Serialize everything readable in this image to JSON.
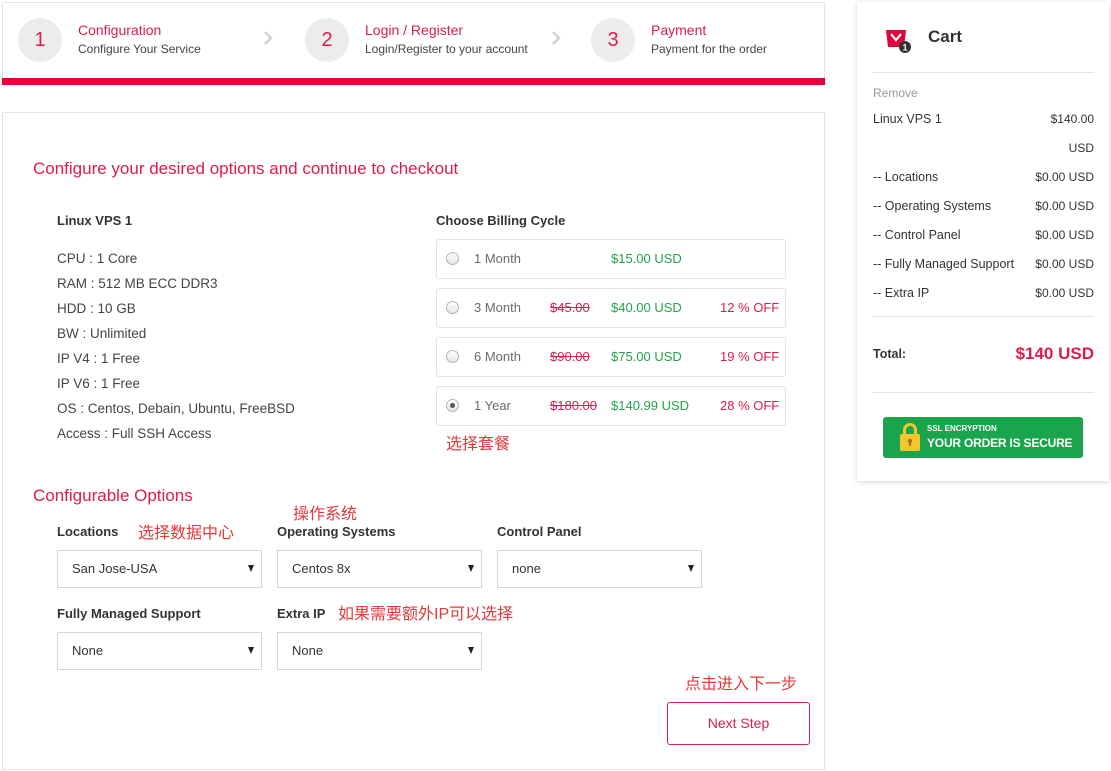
{
  "steps": [
    {
      "number": "1",
      "title": "Configuration",
      "subtitle": "Configure Your Service"
    },
    {
      "number": "2",
      "title": "Login / Register",
      "subtitle": "Login/Register to your account"
    },
    {
      "number": "3",
      "title": "Payment",
      "subtitle": "Payment for the order"
    }
  ],
  "main": {
    "heading": "Configure your desired options and continue to checkout",
    "product": {
      "name": "Linux VPS 1",
      "specs": [
        "CPU : 1 Core",
        "RAM : 512 MB ECC DDR3",
        "HDD : 10 GB",
        "BW : Unlimited",
        "IP V4 : 1 Free",
        "IP V6 : 1 Free",
        "OS : Centos, Debain, Ubuntu, FreeBSD",
        "Access : Full SSH Access"
      ]
    },
    "billing": {
      "title": "Choose Billing Cycle",
      "annotation": "选择套餐",
      "options": [
        {
          "label": "1 Month",
          "price": "$15.00 USD",
          "selected": false
        },
        {
          "label": "3 Month",
          "old_price": "$45.00",
          "price": "$40.00 USD",
          "discount": "12 % OFF",
          "selected": false
        },
        {
          "label": "6 Month",
          "old_price": "$90.00",
          "price": "$75.00 USD",
          "discount": "19 % OFF",
          "selected": false
        },
        {
          "label": "1 Year",
          "old_price": "$180.00",
          "price": "$140.99 USD",
          "discount": "28 % OFF",
          "selected": true
        }
      ]
    },
    "configurable": {
      "heading": "Configurable Options",
      "fields": {
        "locations": {
          "label": "Locations",
          "value": "San Jose-USA",
          "annotation": "选择数据中心"
        },
        "operating_systems": {
          "label": "Operating Systems",
          "value": "Centos 8x",
          "annotation": "操作系统"
        },
        "control_panel": {
          "label": "Control Panel",
          "value": "none"
        },
        "managed_support": {
          "label": "Fully Managed Support",
          "value": "None"
        },
        "extra_ip": {
          "label": "Extra IP",
          "value": "None",
          "annotation": "如果需要额外IP可以选择"
        }
      }
    },
    "next_step": {
      "label": "Next Step",
      "annotation": "点击进入下一步"
    }
  },
  "cart": {
    "title": "Cart",
    "count": "1",
    "remove_label": "Remove",
    "items": [
      {
        "label": "Linux VPS 1",
        "price": "$140.00 USD"
      },
      {
        "label": "-- Locations",
        "price": "$0.00 USD"
      },
      {
        "label": "-- Operating Systems",
        "price": "$0.00 USD"
      },
      {
        "label": "-- Control Panel",
        "price": "$0.00 USD"
      },
      {
        "label": "-- Fully Managed Support",
        "price": "$0.00 USD"
      },
      {
        "label": "-- Extra IP",
        "price": "$0.00 USD"
      }
    ],
    "total_label": "Total:",
    "total_value": "$140 USD",
    "ssl_badge": {
      "line1": "SSL ENCRYPTION",
      "line2": "YOUR ORDER IS SECURE"
    }
  },
  "icons": {
    "step_separator": "chevron-right-icon",
    "cart": "cart-icon",
    "billing_radio": "radio-icon",
    "select_toggle": "caret-down-icon",
    "ssl": "lock-icon"
  },
  "colors": {
    "brand_red": "#e4003a",
    "heading_red": "#dd1c4b",
    "annotation_red": "#e5383b",
    "price_green": "#22a34a",
    "badge_green": "#1aa44b"
  }
}
